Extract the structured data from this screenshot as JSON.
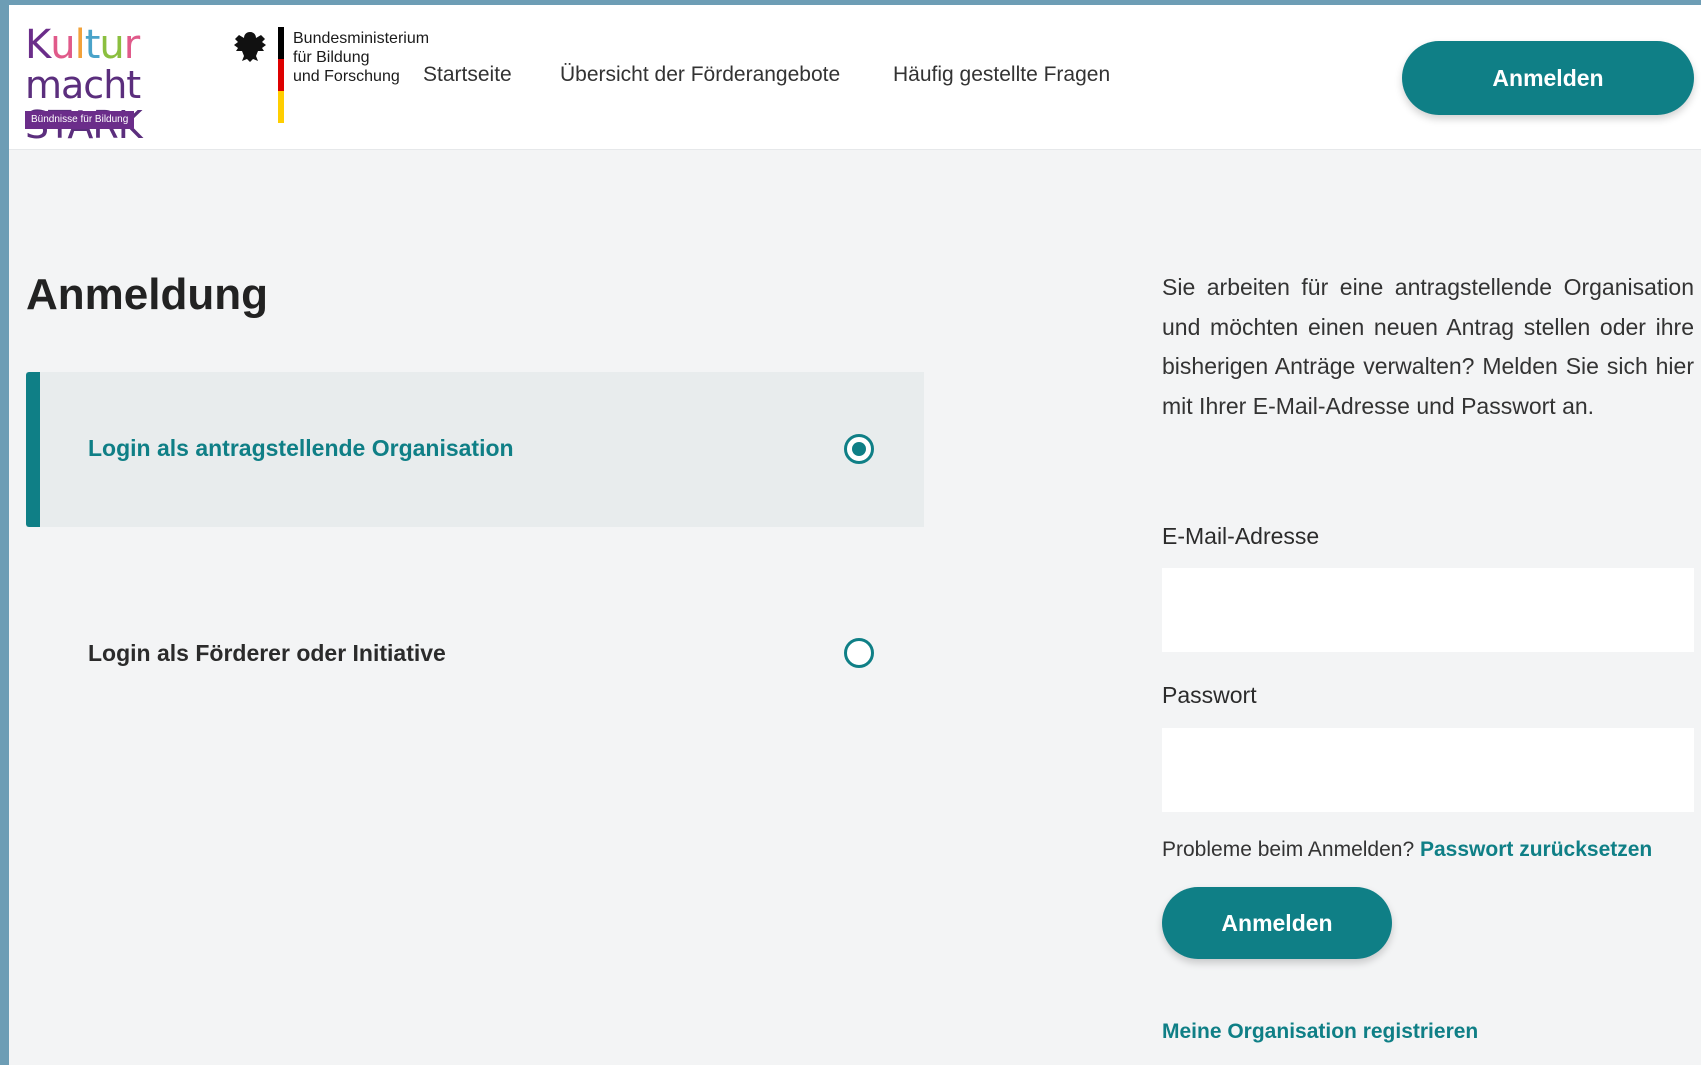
{
  "logo": {
    "line1": [
      "K",
      "u",
      "l",
      "t",
      "u",
      "r"
    ],
    "line1_colors": [
      "#6b2d8a",
      "#e05a8a",
      "#f2a23a",
      "#4aa3c9",
      "#8bbf3f",
      "#e05a8a"
    ],
    "line2": "macht STARK",
    "tagline": "Bündnisse für Bildung"
  },
  "ministry": {
    "line1": "Bundesministerium",
    "line2": "für Bildung",
    "line3": "und Forschung",
    "flag_colors": [
      "#000000",
      "#dd0000",
      "#ffce00"
    ]
  },
  "nav": {
    "items": [
      {
        "label": "Startseite"
      },
      {
        "label": "Übersicht der Förderangebote"
      },
      {
        "label": "Häufig gestellte Fragen"
      }
    ],
    "login_button": "Anmelden"
  },
  "main": {
    "title": "Anmeldung",
    "options": [
      {
        "label": "Login als antragstellende Organisation",
        "selected": true
      },
      {
        "label": "Login als Förderer oder Initiative",
        "selected": false
      }
    ]
  },
  "form": {
    "intro": "Sie arbeiten für eine antragstellende Organisation und möchten einen neuen Antrag stellen oder ihre bisherigen Anträge verwalten? Melden Sie sich hier mit Ihrer E-Mail-Adresse und Passwort an.",
    "email_label": "E-Mail-Adresse",
    "email_value": "",
    "password_label": "Passwort",
    "password_value": "",
    "problems_text": "Probleme beim Anmelden?",
    "reset_link": "Passwort zurücksetzen",
    "submit_button": "Anmelden",
    "register_link": "Meine Organisation registrieren"
  },
  "colors": {
    "accent": "#0f7f86",
    "background": "#f3f4f5",
    "card": "#e8eced"
  }
}
